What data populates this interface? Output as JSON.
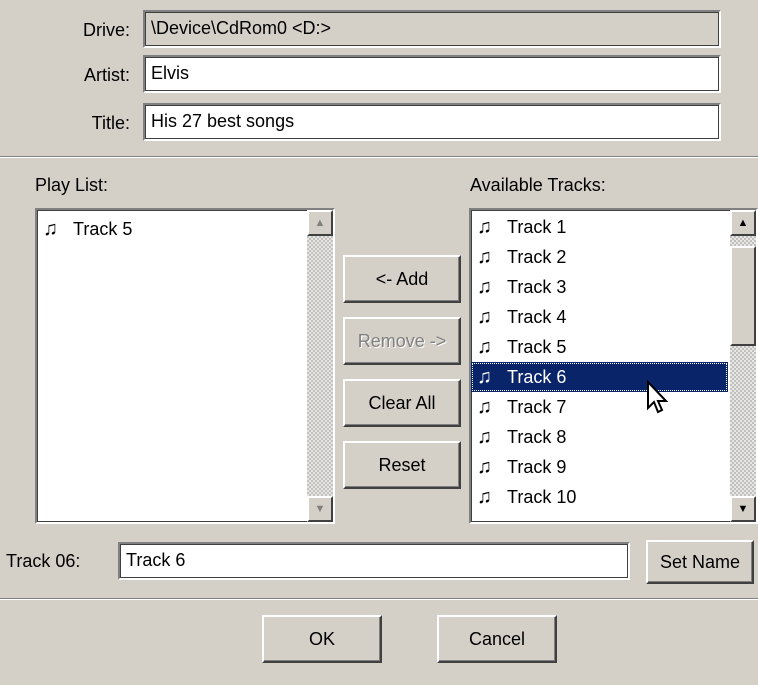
{
  "header": {
    "drive_label": "Drive:",
    "drive_value": "\\Device\\CdRom0 <D:>",
    "artist_label": "Artist:",
    "artist_value": "Elvis",
    "title_label": "Title:",
    "title_value": "His 27 best songs"
  },
  "playlist": {
    "label": "Play List:",
    "items": [
      "Track 5"
    ]
  },
  "available": {
    "label": "Available Tracks:",
    "items": [
      "Track 1",
      "Track 2",
      "Track 3",
      "Track 4",
      "Track 5",
      "Track 6",
      "Track 7",
      "Track 8",
      "Track 9",
      "Track 10"
    ],
    "selected": "Track 6"
  },
  "buttons": {
    "add": "<- Add",
    "remove": "Remove ->",
    "clear_all": "Clear All",
    "reset": "Reset",
    "set_name": "Set Name",
    "ok": "OK",
    "cancel": "Cancel"
  },
  "track_name": {
    "label": "Track 06:",
    "value": "Track 6"
  },
  "colors": {
    "dialog_bg": "#d4d0c8",
    "selection": "#0a246a"
  },
  "icons": {
    "track": "music-note-icon",
    "scroll_up": "scroll-up-arrow-icon",
    "scroll_down": "scroll-down-arrow-icon",
    "cursor": "mouse-pointer-icon"
  }
}
